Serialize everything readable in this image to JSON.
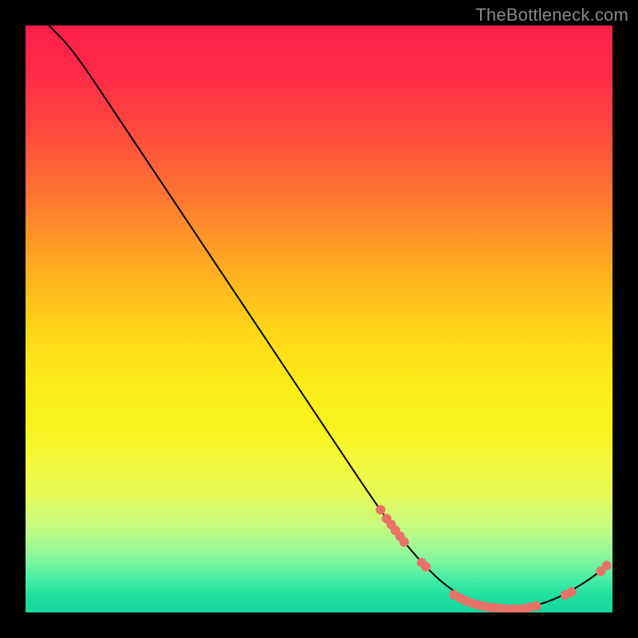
{
  "watermark": "TheBottleneck.com",
  "chart_data": {
    "type": "line",
    "title": "",
    "xlabel": "",
    "ylabel": "",
    "xlim": [
      0,
      100
    ],
    "ylim": [
      0,
      100
    ],
    "grid": false,
    "legend": false,
    "curve_points": [
      {
        "x": 4,
        "y": 100
      },
      {
        "x": 7,
        "y": 97
      },
      {
        "x": 10,
        "y": 93
      },
      {
        "x": 14,
        "y": 87
      },
      {
        "x": 20,
        "y": 78
      },
      {
        "x": 28,
        "y": 66
      },
      {
        "x": 36,
        "y": 54
      },
      {
        "x": 44,
        "y": 42
      },
      {
        "x": 52,
        "y": 30
      },
      {
        "x": 60,
        "y": 18
      },
      {
        "x": 66,
        "y": 10
      },
      {
        "x": 72,
        "y": 4
      },
      {
        "x": 78,
        "y": 1
      },
      {
        "x": 84,
        "y": 0.5
      },
      {
        "x": 90,
        "y": 2
      },
      {
        "x": 96,
        "y": 5.5
      },
      {
        "x": 99,
        "y": 8
      }
    ],
    "marker_clusters": [
      {
        "name": "upper-left-cluster",
        "points": [
          {
            "x": 60.5,
            "y": 17.5
          },
          {
            "x": 61.5,
            "y": 16
          },
          {
            "x": 62.3,
            "y": 15
          },
          {
            "x": 63,
            "y": 14
          },
          {
            "x": 63.8,
            "y": 13
          },
          {
            "x": 64.5,
            "y": 12
          }
        ]
      },
      {
        "name": "mid-pair",
        "points": [
          {
            "x": 67.5,
            "y": 8.5
          },
          {
            "x": 68.2,
            "y": 7.8
          }
        ]
      },
      {
        "name": "bottom-band",
        "points": [
          {
            "x": 73,
            "y": 3
          },
          {
            "x": 74,
            "y": 2.5
          },
          {
            "x": 75,
            "y": 2
          },
          {
            "x": 76,
            "y": 1.6
          },
          {
            "x": 77,
            "y": 1.3
          },
          {
            "x": 78,
            "y": 1.1
          },
          {
            "x": 79,
            "y": 0.9
          },
          {
            "x": 80,
            "y": 0.8
          },
          {
            "x": 81,
            "y": 0.7
          },
          {
            "x": 82,
            "y": 0.6
          },
          {
            "x": 83,
            "y": 0.6
          },
          {
            "x": 84,
            "y": 0.6
          },
          {
            "x": 85,
            "y": 0.7
          },
          {
            "x": 86,
            "y": 0.9
          },
          {
            "x": 87,
            "y": 1.1
          }
        ]
      },
      {
        "name": "right-rise",
        "points": [
          {
            "x": 92,
            "y": 3
          },
          {
            "x": 93,
            "y": 3.5
          }
        ]
      },
      {
        "name": "tail-pair",
        "points": [
          {
            "x": 98,
            "y": 7
          },
          {
            "x": 99,
            "y": 8
          }
        ]
      }
    ],
    "colors": {
      "line": "#000000",
      "marker": "#e77368"
    }
  }
}
